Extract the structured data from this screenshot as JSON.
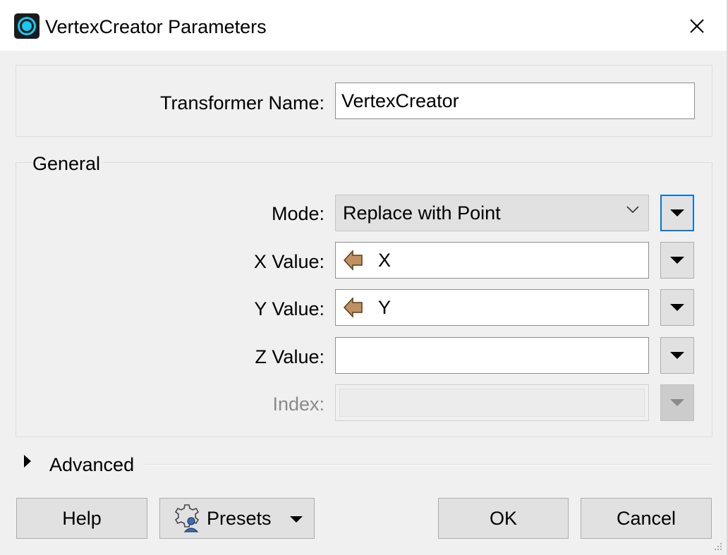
{
  "window": {
    "title": "VertexCreator Parameters"
  },
  "icons": {
    "app": "app-icon",
    "close": "close-icon",
    "dropdown": "triangle-down-icon",
    "attribute": "attribute-arrow-icon",
    "chevron": "chevron-down-icon",
    "expand": "triangle-right-icon",
    "presets": "gear-user-icon"
  },
  "name_section": {
    "label": "Transformer Name:",
    "value": "VertexCreator"
  },
  "general": {
    "title": "General",
    "mode": {
      "label": "Mode:",
      "value": "Replace with Point"
    },
    "x_value": {
      "label": "X Value:",
      "value": "X"
    },
    "y_value": {
      "label": "Y Value:",
      "value": "Y"
    },
    "z_value": {
      "label": "Z Value:",
      "value": ""
    },
    "index": {
      "label": "Index:",
      "value": ""
    }
  },
  "advanced": {
    "label": "Advanced"
  },
  "buttons": {
    "help": "Help",
    "presets": "Presets",
    "ok": "OK",
    "cancel": "Cancel"
  },
  "colors": {
    "focus": "#0078d7",
    "app_icon_accent": "#18c8f2",
    "attribute_icon": "#c09060"
  }
}
